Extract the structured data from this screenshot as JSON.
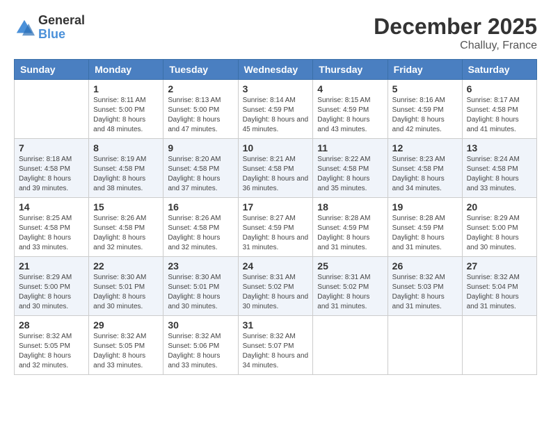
{
  "logo": {
    "general": "General",
    "blue": "Blue"
  },
  "header": {
    "month": "December 2025",
    "location": "Challuy, France"
  },
  "days_of_week": [
    "Sunday",
    "Monday",
    "Tuesday",
    "Wednesday",
    "Thursday",
    "Friday",
    "Saturday"
  ],
  "weeks": [
    [
      {
        "day": "",
        "sunrise": "",
        "sunset": "",
        "daylight": ""
      },
      {
        "day": "1",
        "sunrise": "Sunrise: 8:11 AM",
        "sunset": "Sunset: 5:00 PM",
        "daylight": "Daylight: 8 hours and 48 minutes."
      },
      {
        "day": "2",
        "sunrise": "Sunrise: 8:13 AM",
        "sunset": "Sunset: 5:00 PM",
        "daylight": "Daylight: 8 hours and 47 minutes."
      },
      {
        "day": "3",
        "sunrise": "Sunrise: 8:14 AM",
        "sunset": "Sunset: 4:59 PM",
        "daylight": "Daylight: 8 hours and 45 minutes."
      },
      {
        "day": "4",
        "sunrise": "Sunrise: 8:15 AM",
        "sunset": "Sunset: 4:59 PM",
        "daylight": "Daylight: 8 hours and 43 minutes."
      },
      {
        "day": "5",
        "sunrise": "Sunrise: 8:16 AM",
        "sunset": "Sunset: 4:59 PM",
        "daylight": "Daylight: 8 hours and 42 minutes."
      },
      {
        "day": "6",
        "sunrise": "Sunrise: 8:17 AM",
        "sunset": "Sunset: 4:58 PM",
        "daylight": "Daylight: 8 hours and 41 minutes."
      }
    ],
    [
      {
        "day": "7",
        "sunrise": "Sunrise: 8:18 AM",
        "sunset": "Sunset: 4:58 PM",
        "daylight": "Daylight: 8 hours and 39 minutes."
      },
      {
        "day": "8",
        "sunrise": "Sunrise: 8:19 AM",
        "sunset": "Sunset: 4:58 PM",
        "daylight": "Daylight: 8 hours and 38 minutes."
      },
      {
        "day": "9",
        "sunrise": "Sunrise: 8:20 AM",
        "sunset": "Sunset: 4:58 PM",
        "daylight": "Daylight: 8 hours and 37 minutes."
      },
      {
        "day": "10",
        "sunrise": "Sunrise: 8:21 AM",
        "sunset": "Sunset: 4:58 PM",
        "daylight": "Daylight: 8 hours and 36 minutes."
      },
      {
        "day": "11",
        "sunrise": "Sunrise: 8:22 AM",
        "sunset": "Sunset: 4:58 PM",
        "daylight": "Daylight: 8 hours and 35 minutes."
      },
      {
        "day": "12",
        "sunrise": "Sunrise: 8:23 AM",
        "sunset": "Sunset: 4:58 PM",
        "daylight": "Daylight: 8 hours and 34 minutes."
      },
      {
        "day": "13",
        "sunrise": "Sunrise: 8:24 AM",
        "sunset": "Sunset: 4:58 PM",
        "daylight": "Daylight: 8 hours and 33 minutes."
      }
    ],
    [
      {
        "day": "14",
        "sunrise": "Sunrise: 8:25 AM",
        "sunset": "Sunset: 4:58 PM",
        "daylight": "Daylight: 8 hours and 33 minutes."
      },
      {
        "day": "15",
        "sunrise": "Sunrise: 8:26 AM",
        "sunset": "Sunset: 4:58 PM",
        "daylight": "Daylight: 8 hours and 32 minutes."
      },
      {
        "day": "16",
        "sunrise": "Sunrise: 8:26 AM",
        "sunset": "Sunset: 4:58 PM",
        "daylight": "Daylight: 8 hours and 32 minutes."
      },
      {
        "day": "17",
        "sunrise": "Sunrise: 8:27 AM",
        "sunset": "Sunset: 4:59 PM",
        "daylight": "Daylight: 8 hours and 31 minutes."
      },
      {
        "day": "18",
        "sunrise": "Sunrise: 8:28 AM",
        "sunset": "Sunset: 4:59 PM",
        "daylight": "Daylight: 8 hours and 31 minutes."
      },
      {
        "day": "19",
        "sunrise": "Sunrise: 8:28 AM",
        "sunset": "Sunset: 4:59 PM",
        "daylight": "Daylight: 8 hours and 31 minutes."
      },
      {
        "day": "20",
        "sunrise": "Sunrise: 8:29 AM",
        "sunset": "Sunset: 5:00 PM",
        "daylight": "Daylight: 8 hours and 30 minutes."
      }
    ],
    [
      {
        "day": "21",
        "sunrise": "Sunrise: 8:29 AM",
        "sunset": "Sunset: 5:00 PM",
        "daylight": "Daylight: 8 hours and 30 minutes."
      },
      {
        "day": "22",
        "sunrise": "Sunrise: 8:30 AM",
        "sunset": "Sunset: 5:01 PM",
        "daylight": "Daylight: 8 hours and 30 minutes."
      },
      {
        "day": "23",
        "sunrise": "Sunrise: 8:30 AM",
        "sunset": "Sunset: 5:01 PM",
        "daylight": "Daylight: 8 hours and 30 minutes."
      },
      {
        "day": "24",
        "sunrise": "Sunrise: 8:31 AM",
        "sunset": "Sunset: 5:02 PM",
        "daylight": "Daylight: 8 hours and 30 minutes."
      },
      {
        "day": "25",
        "sunrise": "Sunrise: 8:31 AM",
        "sunset": "Sunset: 5:02 PM",
        "daylight": "Daylight: 8 hours and 31 minutes."
      },
      {
        "day": "26",
        "sunrise": "Sunrise: 8:32 AM",
        "sunset": "Sunset: 5:03 PM",
        "daylight": "Daylight: 8 hours and 31 minutes."
      },
      {
        "day": "27",
        "sunrise": "Sunrise: 8:32 AM",
        "sunset": "Sunset: 5:04 PM",
        "daylight": "Daylight: 8 hours and 31 minutes."
      }
    ],
    [
      {
        "day": "28",
        "sunrise": "Sunrise: 8:32 AM",
        "sunset": "Sunset: 5:05 PM",
        "daylight": "Daylight: 8 hours and 32 minutes."
      },
      {
        "day": "29",
        "sunrise": "Sunrise: 8:32 AM",
        "sunset": "Sunset: 5:05 PM",
        "daylight": "Daylight: 8 hours and 33 minutes."
      },
      {
        "day": "30",
        "sunrise": "Sunrise: 8:32 AM",
        "sunset": "Sunset: 5:06 PM",
        "daylight": "Daylight: 8 hours and 33 minutes."
      },
      {
        "day": "31",
        "sunrise": "Sunrise: 8:32 AM",
        "sunset": "Sunset: 5:07 PM",
        "daylight": "Daylight: 8 hours and 34 minutes."
      },
      {
        "day": "",
        "sunrise": "",
        "sunset": "",
        "daylight": ""
      },
      {
        "day": "",
        "sunrise": "",
        "sunset": "",
        "daylight": ""
      },
      {
        "day": "",
        "sunrise": "",
        "sunset": "",
        "daylight": ""
      }
    ]
  ]
}
